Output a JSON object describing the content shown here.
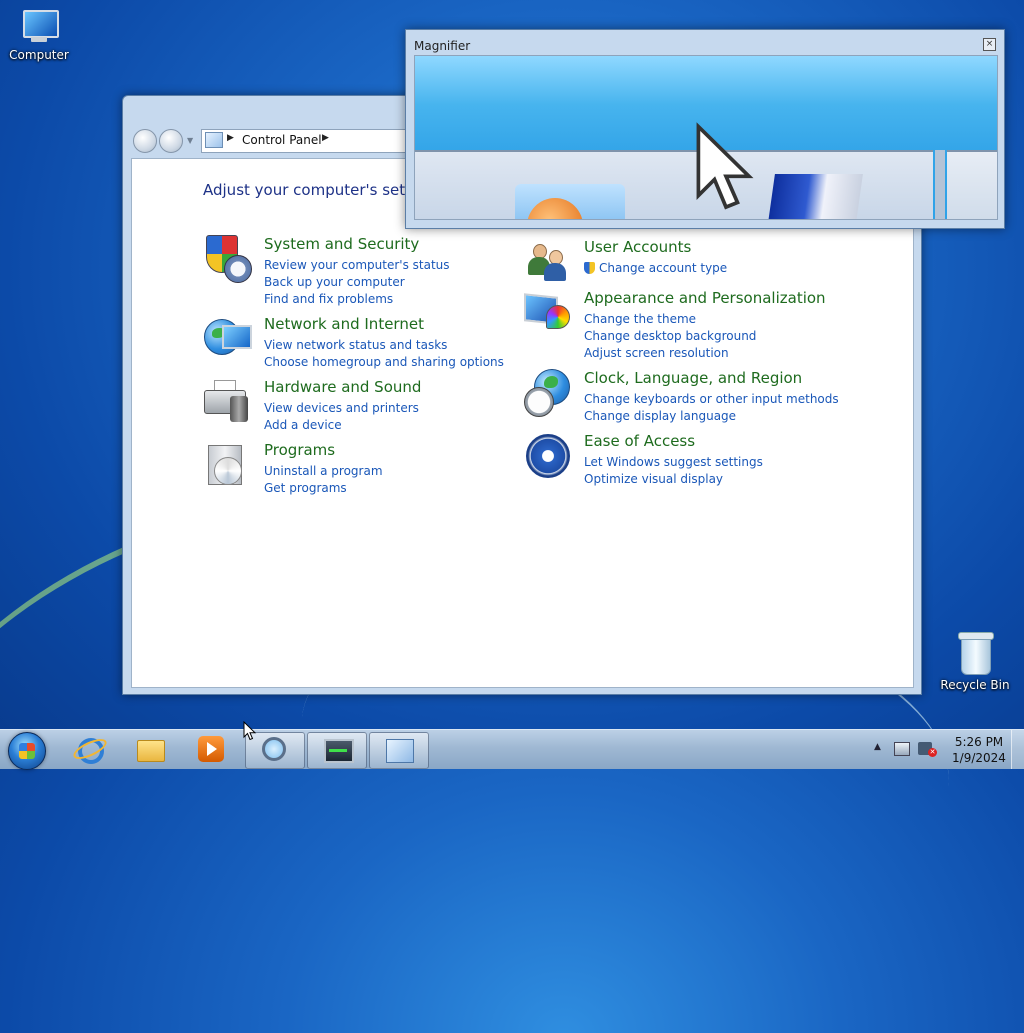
{
  "desktop": {
    "icons": [
      {
        "label": "Computer",
        "icon": "computer-icon"
      },
      {
        "label": "Recycle Bin",
        "icon": "recycle-bin-icon"
      }
    ]
  },
  "control_panel": {
    "breadcrumb": {
      "root_icon": "control-panel-icon",
      "label": "Control Panel"
    },
    "heading": "Adjust your computer's settin",
    "categories": [
      {
        "title": "System and Security",
        "icon": "security-shield-icon",
        "links": [
          "Review your computer's status",
          "Back up your computer",
          "Find and fix problems"
        ]
      },
      {
        "title": "Network and Internet",
        "icon": "network-globe-icon",
        "links": [
          "View network status and tasks",
          "Choose homegroup and sharing options"
        ]
      },
      {
        "title": "Hardware and Sound",
        "icon": "printer-speaker-icon",
        "links": [
          "View devices and printers",
          "Add a device"
        ]
      },
      {
        "title": "Programs",
        "icon": "programs-box-icon",
        "links": [
          "Uninstall a program",
          "Get programs"
        ]
      },
      {
        "title": "User Accounts",
        "icon": "users-icon",
        "links": [
          "Change account type"
        ]
      },
      {
        "title": "Appearance and Personalization",
        "icon": "monitor-palette-icon",
        "links": [
          "Change the theme",
          "Change desktop background",
          "Adjust screen resolution"
        ]
      },
      {
        "title": "Clock, Language, and Region",
        "icon": "globe-clock-icon",
        "links": [
          "Change keyboards or other input methods",
          "Change display language"
        ]
      },
      {
        "title": "Ease of Access",
        "icon": "ease-of-access-icon",
        "links": [
          "Let Windows suggest settings",
          "Optimize visual display"
        ]
      }
    ]
  },
  "magnifier": {
    "title": "Magnifier"
  },
  "taskbar": {
    "pinned": [
      "start-orb",
      "internet-explorer-icon",
      "windows-explorer-icon",
      "media-player-icon",
      "magnifier-icon",
      "task-manager-icon",
      "control-panel-icon"
    ],
    "tray": {
      "time": "5:26 PM",
      "date": "1/9/2024"
    }
  }
}
